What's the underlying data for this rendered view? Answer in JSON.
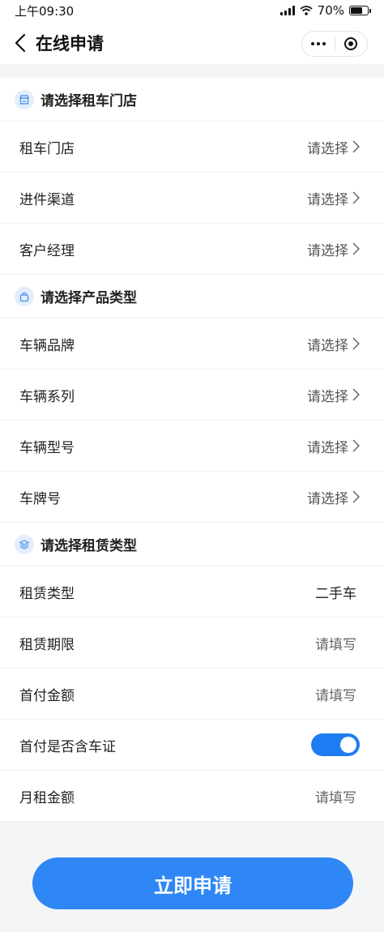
{
  "status_bar": {
    "time": "上午09:30",
    "battery": "70%"
  },
  "nav": {
    "title": "在线申请"
  },
  "sections": [
    {
      "title": "请选择租车门店",
      "icon": "store-icon",
      "rows": [
        {
          "label": "租车门店",
          "value": "请选择"
        },
        {
          "label": "进件渠道",
          "value": "请选择"
        },
        {
          "label": "客户经理",
          "value": "请选择"
        }
      ]
    },
    {
      "title": "请选择产品类型",
      "icon": "bag-icon",
      "rows": [
        {
          "label": "车辆品牌",
          "value": "请选择"
        },
        {
          "label": "车辆系列",
          "value": "请选择"
        },
        {
          "label": "车辆型号",
          "value": "请选择"
        },
        {
          "label": "车牌号",
          "value": "请选择"
        }
      ]
    },
    {
      "title": "请选择租赁类型",
      "icon": "layers-icon",
      "rows": [
        {
          "label": "租赁类型",
          "value": "二手车"
        },
        {
          "label": "租赁期限",
          "value": "请填写"
        },
        {
          "label": "首付金额",
          "value": "请填写"
        },
        {
          "label": "首付是否含车证",
          "toggle": true
        },
        {
          "label": "月租金额",
          "value": "请填写"
        }
      ]
    }
  ],
  "submit_label": "立即申请",
  "colors": {
    "accent": "#2e87f5",
    "icon_bg": "#e2eefc"
  }
}
